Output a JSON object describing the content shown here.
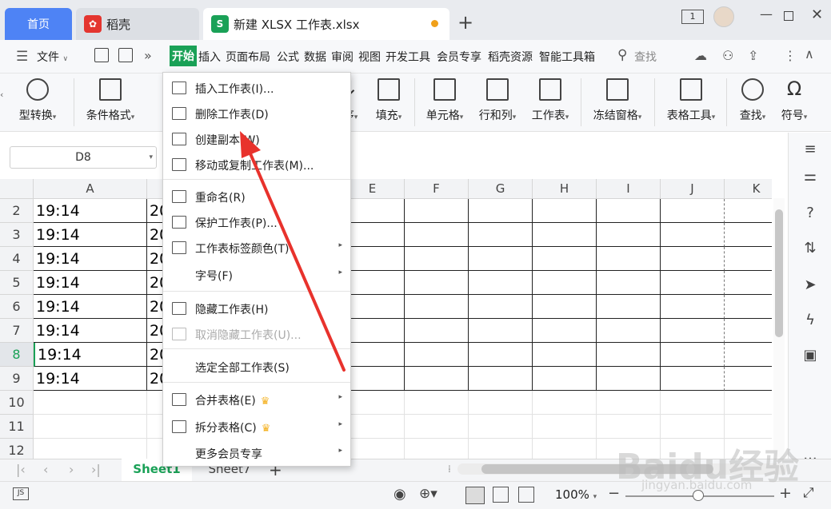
{
  "tabs": {
    "home": "首页",
    "daoke": "稻壳",
    "doc": "新建 XLSX 工作表.xlsx",
    "doc_logo": "S"
  },
  "window": {
    "page_indicator": "1"
  },
  "menubar": {
    "file": "文件",
    "items": [
      "开始",
      "插入",
      "页面布局",
      "公式",
      "数据",
      "审阅",
      "视图",
      "开发工具",
      "会员专享",
      "稻壳资源",
      "智能工具箱"
    ],
    "search": "查找"
  },
  "ribbon": {
    "items": [
      {
        "label": "类型转换",
        "shown": "型转换"
      },
      {
        "label": "条件格式"
      },
      {
        "label": "排序",
        "shown": "序"
      },
      {
        "label": "填充"
      },
      {
        "label": "单元格"
      },
      {
        "label": "行和列"
      },
      {
        "label": "工作表"
      },
      {
        "label": "冻结窗格"
      },
      {
        "label": "表格工具"
      },
      {
        "label": "查找"
      },
      {
        "label": "符号"
      }
    ]
  },
  "namebox": "D8",
  "grid": {
    "columns": [
      "A",
      "",
      "",
      "",
      "E",
      "F",
      "G",
      "H",
      "I",
      "J",
      "K"
    ],
    "rows": [
      {
        "num": "2",
        "a": "19:14",
        "b": "20"
      },
      {
        "num": "3",
        "a": "19:14",
        "b": "20"
      },
      {
        "num": "4",
        "a": "19:14",
        "b": "20"
      },
      {
        "num": "5",
        "a": "19:14",
        "b": "20"
      },
      {
        "num": "6",
        "a": "19:14",
        "b": "20"
      },
      {
        "num": "7",
        "a": "19:14",
        "b": "20"
      },
      {
        "num": "8",
        "a": "19:14",
        "b": "20",
        "active": true
      },
      {
        "num": "9",
        "a": "19:14",
        "b": "20"
      },
      {
        "num": "10",
        "a": "",
        "b": ""
      },
      {
        "num": "11",
        "a": "",
        "b": ""
      },
      {
        "num": "12",
        "a": "",
        "b": ""
      }
    ]
  },
  "context_menu": {
    "items": [
      {
        "label": "插入工作表(I)...",
        "icon": "insert-sheet-icon"
      },
      {
        "label": "删除工作表(D)",
        "icon": "delete-sheet-icon"
      },
      {
        "label": "创建副本(W)",
        "icon": "copy-sheet-icon"
      },
      {
        "label": "移动或复制工作表(M)...",
        "icon": "move-sheet-icon"
      },
      {
        "label": "重命名(R)",
        "icon": "rename-icon"
      },
      {
        "label": "保护工作表(P)...",
        "icon": "protect-sheet-icon"
      },
      {
        "label": "工作表标签颜色(T)",
        "icon": "tab-color-icon",
        "submenu": true
      },
      {
        "label": "字号(F)",
        "submenu": true
      },
      {
        "label": "隐藏工作表(H)",
        "icon": "hide-eye-icon"
      },
      {
        "label": "取消隐藏工作表(U)...",
        "icon": "unhide-eye-icon",
        "disabled": true
      },
      {
        "label": "选定全部工作表(S)"
      },
      {
        "label": "合并表格(E)",
        "icon": "merge-table-icon",
        "submenu": true,
        "crown": true
      },
      {
        "label": "拆分表格(C)",
        "icon": "split-table-icon",
        "submenu": true,
        "crown": true
      },
      {
        "label": "更多会员专享",
        "submenu": true
      }
    ]
  },
  "sheets": {
    "active": "Sheet1",
    "other": "Sheet7"
  },
  "status": {
    "zoom": "100%"
  },
  "watermark": {
    "main": "Baidu经验",
    "sub": "jingyan.baidu.com"
  },
  "colors": {
    "accent_green": "#1aa157",
    "home_tab_blue": "#4e83f5",
    "arrow_red": "#e8322c"
  }
}
